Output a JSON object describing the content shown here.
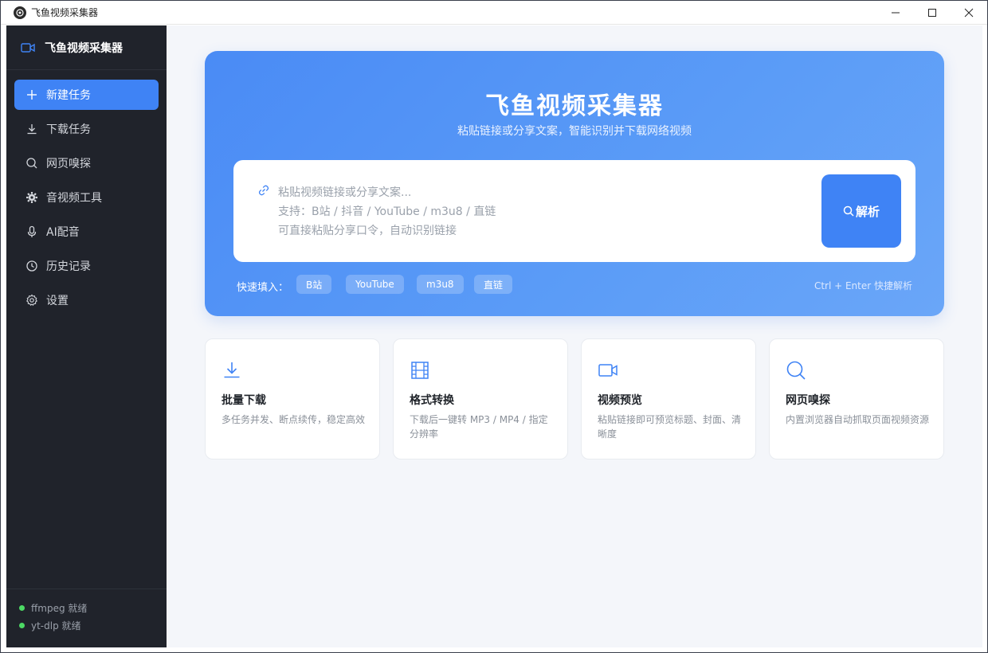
{
  "window": {
    "title": "飞鱼视频采集器"
  },
  "sidebar": {
    "brand": "飞鱼视频采集器",
    "items": [
      {
        "label": "新建任务",
        "icon": "plus-icon",
        "active": true
      },
      {
        "label": "下载任务",
        "icon": "download-icon",
        "active": false
      },
      {
        "label": "网页嗅探",
        "icon": "search-icon",
        "active": false
      },
      {
        "label": "音视频工具",
        "icon": "gear-icon",
        "active": false
      },
      {
        "label": "AI配音",
        "icon": "microphone-icon",
        "active": false
      },
      {
        "label": "历史记录",
        "icon": "clock-icon",
        "active": false
      },
      {
        "label": "设置",
        "icon": "settings-icon",
        "active": false
      }
    ],
    "status": [
      {
        "label": "ffmpeg 就绪",
        "color": "#4cd964"
      },
      {
        "label": "yt-dlp 就绪",
        "color": "#4cd964"
      }
    ]
  },
  "hero": {
    "title": "飞鱼视频采集器",
    "subtitle": "粘贴链接或分享文案，智能识别并下载网络视频",
    "input": {
      "placeholder_line1": "粘贴视频链接或分享文案...",
      "placeholder_line2": "支持：B站 / 抖音 / YouTube / m3u8 / 直链",
      "placeholder_line3": "可直接粘贴分享口令，自动识别链接"
    },
    "parse_button": "解析",
    "quick_fill_label": "快速填入：",
    "quick_fill": [
      "B站",
      "YouTube",
      "m3u8",
      "直链"
    ],
    "shortcut_hint": "Ctrl + Enter 快捷解析"
  },
  "features": [
    {
      "title": "批量下载",
      "desc": "多任务并发、断点续传，稳定高效",
      "icon": "download-icon"
    },
    {
      "title": "格式转换",
      "desc": "下载后一键转 MP3 / MP4 / 指定分辨率",
      "icon": "film-icon"
    },
    {
      "title": "视频预览",
      "desc": "粘贴链接即可预览标题、封面、清晰度",
      "icon": "video-camera-icon"
    },
    {
      "title": "网页嗅探",
      "desc": "内置浏览器自动抓取页面视频资源",
      "icon": "search-icon"
    }
  ],
  "colors": {
    "accent": "#3f83f5",
    "sidebar_bg": "#20232b",
    "status_ok": "#4cd964"
  }
}
